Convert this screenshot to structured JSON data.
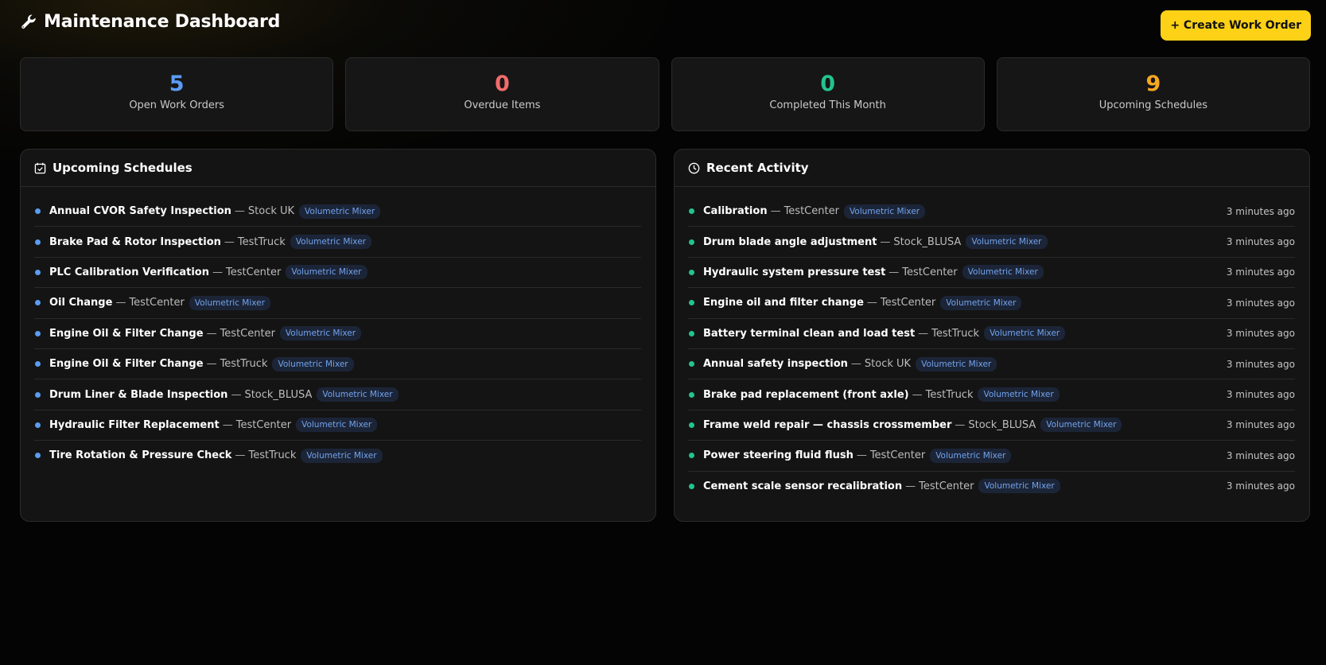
{
  "header": {
    "title": "Maintenance Dashboard",
    "icon": "wrench-icon",
    "create_button": "+ Create Work Order"
  },
  "colors": {
    "accent": "#fcd116",
    "blue": "#5b9cf4",
    "red": "#f26b6b",
    "green": "#22c48f",
    "orange": "#f5a623"
  },
  "stats": [
    {
      "value": "5",
      "label": "Open Work Orders",
      "color": "#5b9cf4"
    },
    {
      "value": "0",
      "label": "Overdue Items",
      "color": "#f26b6b"
    },
    {
      "value": "0",
      "label": "Completed This Month",
      "color": "#22c48f"
    },
    {
      "value": "9",
      "label": "Upcoming Schedules",
      "color": "#f5a623"
    }
  ],
  "schedules": {
    "title": "Upcoming Schedules",
    "icon": "calendar-check-icon",
    "items": [
      {
        "title": "Annual CVOR Safety Inspection",
        "sep": "—",
        "location": "Stock UK",
        "tag": "Volumetric Mixer"
      },
      {
        "title": "Brake Pad & Rotor Inspection",
        "sep": "—",
        "location": "TestTruck",
        "tag": "Volumetric Mixer"
      },
      {
        "title": "PLC Calibration Verification",
        "sep": "—",
        "location": "TestCenter",
        "tag": "Volumetric Mixer"
      },
      {
        "title": "Oil Change",
        "sep": "—",
        "location": "TestCenter",
        "tag": "Volumetric Mixer"
      },
      {
        "title": "Engine Oil & Filter Change",
        "sep": "—",
        "location": "TestCenter",
        "tag": "Volumetric Mixer"
      },
      {
        "title": "Engine Oil & Filter Change",
        "sep": "—",
        "location": "TestTruck",
        "tag": "Volumetric Mixer"
      },
      {
        "title": "Drum Liner & Blade Inspection",
        "sep": "—",
        "location": "Stock_BLUSA",
        "tag": "Volumetric Mixer"
      },
      {
        "title": "Hydraulic Filter Replacement",
        "sep": "—",
        "location": "TestCenter",
        "tag": "Volumetric Mixer"
      },
      {
        "title": "Tire Rotation & Pressure Check",
        "sep": "—",
        "location": "TestTruck",
        "tag": "Volumetric Mixer"
      }
    ]
  },
  "activity": {
    "title": "Recent Activity",
    "icon": "clock-icon",
    "items": [
      {
        "title": "Calibration",
        "sep": "—",
        "location": "TestCenter",
        "tag": "Volumetric Mixer",
        "time": "3 minutes ago"
      },
      {
        "title": "Drum blade angle adjustment",
        "sep": "—",
        "location": "Stock_BLUSA",
        "tag": "Volumetric Mixer",
        "time": "3 minutes ago"
      },
      {
        "title": "Hydraulic system pressure test",
        "sep": "—",
        "location": "TestCenter",
        "tag": "Volumetric Mixer",
        "time": "3 minutes ago"
      },
      {
        "title": "Engine oil and filter change",
        "sep": "—",
        "location": "TestCenter",
        "tag": "Volumetric Mixer",
        "time": "3 minutes ago"
      },
      {
        "title": "Battery terminal clean and load test",
        "sep": "—",
        "location": "TestTruck",
        "tag": "Volumetric Mixer",
        "time": "3 minutes ago"
      },
      {
        "title": "Annual safety inspection",
        "sep": "—",
        "location": "Stock UK",
        "tag": "Volumetric Mixer",
        "time": "3 minutes ago"
      },
      {
        "title": "Brake pad replacement (front axle)",
        "sep": "—",
        "location": "TestTruck",
        "tag": "Volumetric Mixer",
        "time": "3 minutes ago"
      },
      {
        "title": "Frame weld repair — chassis crossmember",
        "sep": "—",
        "location": "Stock_BLUSA",
        "tag": "Volumetric Mixer",
        "time": "3 minutes ago"
      },
      {
        "title": "Power steering fluid flush",
        "sep": "—",
        "location": "TestCenter",
        "tag": "Volumetric Mixer",
        "time": "3 minutes ago"
      },
      {
        "title": "Cement scale sensor recalibration",
        "sep": "—",
        "location": "TestCenter",
        "tag": "Volumetric Mixer",
        "time": "3 minutes ago"
      }
    ]
  }
}
